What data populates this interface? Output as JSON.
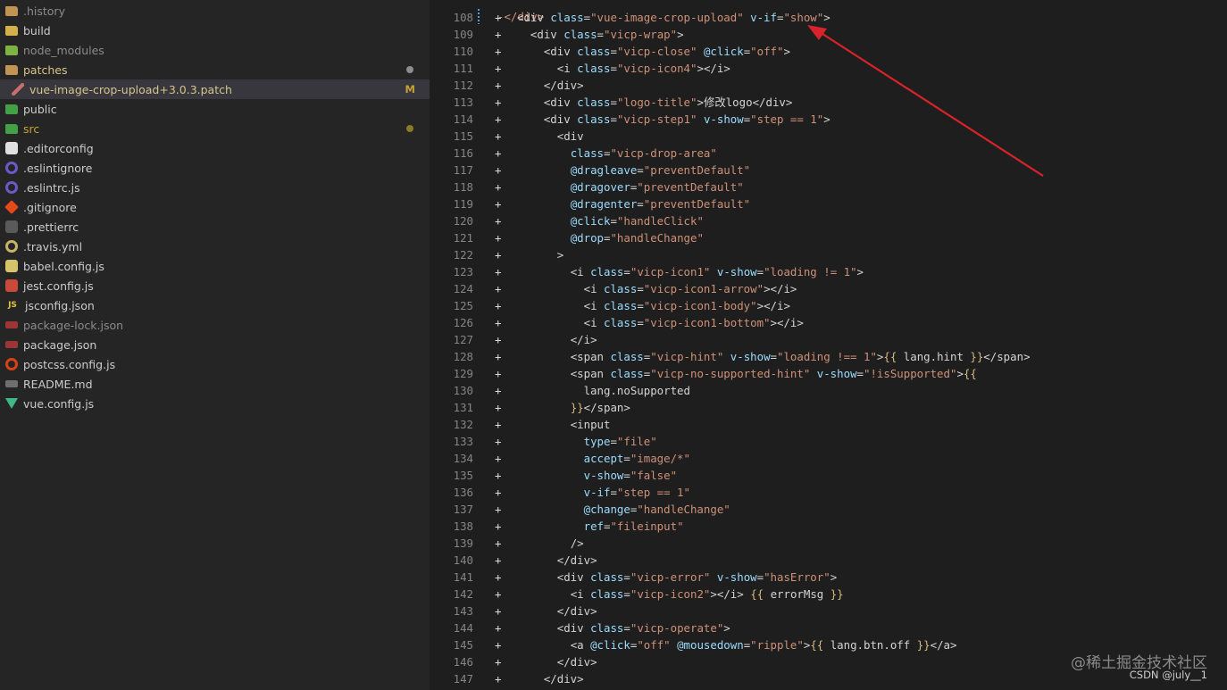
{
  "explorer": {
    "items": [
      {
        "label": ".history",
        "icon": "folder-icon",
        "icon_text": "",
        "icon_color": "#c09553",
        "label_color": "#8b8b8b"
      },
      {
        "label": "build",
        "icon": "build-folder-icon",
        "icon_text": "",
        "icon_color": "#d4b04d",
        "label_color": "#cccccc"
      },
      {
        "label": "node_modules",
        "icon": "node-modules-folder-icon",
        "icon_text": "",
        "icon_color": "#7cb342",
        "label_color": "#8b8b8b"
      },
      {
        "label": "patches",
        "icon": "folder-icon",
        "icon_text": "",
        "icon_color": "#c09553",
        "label_color": "#d7c48c",
        "dot_color": "#8d8d8d"
      },
      {
        "label": "vue-image-crop-upload+3.0.3.patch",
        "icon": "patch-file-icon",
        "icon_text": "",
        "icon_color": "#c56f6f",
        "label_color": "#d7c48c",
        "badge": "M",
        "selected": true,
        "indent": true
      },
      {
        "label": "public",
        "icon": "public-folder-icon",
        "icon_text": "",
        "icon_color": "#43a047",
        "label_color": "#cccccc"
      },
      {
        "label": "src",
        "icon": "src-folder-icon",
        "icon_text": "",
        "icon_color": "#43a047",
        "label_color": "#c5a333",
        "dot_color": "#8a7a2a"
      },
      {
        "label": ".editorconfig",
        "icon": "editorconfig-icon",
        "icon_text": "",
        "icon_color": "#e0e0e0",
        "label_color": "#cccccc"
      },
      {
        "label": ".eslintignore",
        "icon": "eslint-icon",
        "icon_text": "",
        "icon_color": "#6d58c9",
        "label_color": "#cccccc"
      },
      {
        "label": ".eslintrc.js",
        "icon": "eslint-icon",
        "icon_text": "",
        "icon_color": "#6d58c9",
        "label_color": "#cccccc"
      },
      {
        "label": ".gitignore",
        "icon": "git-icon",
        "icon_text": "",
        "icon_color": "#e64a19",
        "label_color": "#cccccc"
      },
      {
        "label": ".prettierrc",
        "icon": "prettier-icon",
        "icon_text": "",
        "icon_color": "#5a5a5a",
        "label_color": "#cccccc"
      },
      {
        "label": ".travis.yml",
        "icon": "travis-icon",
        "icon_text": "",
        "icon_color": "#c8b468",
        "label_color": "#cccccc"
      },
      {
        "label": "babel.config.js",
        "icon": "babel-icon",
        "icon_text": "",
        "icon_color": "#d6c46a",
        "label_color": "#cccccc"
      },
      {
        "label": "jest.config.js",
        "icon": "jest-icon",
        "icon_text": "",
        "icon_color": "#c74a3b",
        "label_color": "#cccccc"
      },
      {
        "label": "jsconfig.json",
        "icon": "js-icon",
        "icon_text": "JS",
        "icon_color": "#e0c341",
        "label_color": "#cccccc"
      },
      {
        "label": "package-lock.json",
        "icon": "npm-icon",
        "icon_text": "",
        "icon_color": "#b23a3a",
        "label_color": "#8b8b8b"
      },
      {
        "label": "package.json",
        "icon": "npm-icon",
        "icon_text": "",
        "icon_color": "#b23a3a",
        "label_color": "#cccccc"
      },
      {
        "label": "postcss.config.js",
        "icon": "postcss-icon",
        "icon_text": "",
        "icon_color": "#d84315",
        "label_color": "#cccccc"
      },
      {
        "label": "README.md",
        "icon": "markdown-icon",
        "icon_text": "",
        "icon_color": "#7d7d7d",
        "label_color": "#cccccc"
      },
      {
        "label": "vue.config.js",
        "icon": "vue-icon",
        "icon_text": "",
        "icon_color": "#41b883",
        "label_color": "#cccccc"
      }
    ]
  },
  "code": {
    "colors": {
      "tag": "#d4d4d4",
      "attr": "#9cdcfe",
      "str": "#ce9178",
      "brace": "#d7ba7d"
    },
    "top_partial": "-</div>",
    "lines": [
      {
        "n": "108",
        "text": "<div class=\"vue-image-crop-upload\" v-if=\"show\">"
      },
      {
        "n": "109",
        "text": "  <div class=\"vicp-wrap\">"
      },
      {
        "n": "110",
        "text": "    <div class=\"vicp-close\" @click=\"off\">"
      },
      {
        "n": "111",
        "text": "      <i class=\"vicp-icon4\"></i>"
      },
      {
        "n": "112",
        "text": "    </div>"
      },
      {
        "n": "113",
        "text": "    <div class=\"logo-title\">修改logo</div>"
      },
      {
        "n": "114",
        "text": "    <div class=\"vicp-step1\" v-show=\"step == 1\">"
      },
      {
        "n": "115",
        "text": "      <div"
      },
      {
        "n": "116",
        "text": "        class=\"vicp-drop-area\""
      },
      {
        "n": "117",
        "text": "        @dragleave=\"preventDefault\""
      },
      {
        "n": "118",
        "text": "        @dragover=\"preventDefault\""
      },
      {
        "n": "119",
        "text": "        @dragenter=\"preventDefault\""
      },
      {
        "n": "120",
        "text": "        @click=\"handleClick\""
      },
      {
        "n": "121",
        "text": "        @drop=\"handleChange\""
      },
      {
        "n": "122",
        "text": "      >"
      },
      {
        "n": "123",
        "text": "        <i class=\"vicp-icon1\" v-show=\"loading != 1\">"
      },
      {
        "n": "124",
        "text": "          <i class=\"vicp-icon1-arrow\"></i>"
      },
      {
        "n": "125",
        "text": "          <i class=\"vicp-icon1-body\"></i>"
      },
      {
        "n": "126",
        "text": "          <i class=\"vicp-icon1-bottom\"></i>"
      },
      {
        "n": "127",
        "text": "        </i>"
      },
      {
        "n": "128",
        "text": "        <span class=\"vicp-hint\" v-show=\"loading !== 1\">{{ lang.hint }}</span>"
      },
      {
        "n": "129",
        "text": "        <span class=\"vicp-no-supported-hint\" v-show=\"!isSupported\">{{"
      },
      {
        "n": "130",
        "text": "          lang.noSupported"
      },
      {
        "n": "131",
        "text": "        }}</span>"
      },
      {
        "n": "132",
        "text": "        <input"
      },
      {
        "n": "133",
        "text": "          type=\"file\""
      },
      {
        "n": "134",
        "text": "          accept=\"image/*\""
      },
      {
        "n": "135",
        "text": "          v-show=\"false\""
      },
      {
        "n": "136",
        "text": "          v-if=\"step == 1\""
      },
      {
        "n": "137",
        "text": "          @change=\"handleChange\""
      },
      {
        "n": "138",
        "text": "          ref=\"fileinput\""
      },
      {
        "n": "139",
        "text": "        />"
      },
      {
        "n": "140",
        "text": "      </div>"
      },
      {
        "n": "141",
        "text": "      <div class=\"vicp-error\" v-show=\"hasError\">"
      },
      {
        "n": "142",
        "text": "        <i class=\"vicp-icon2\"></i> {{ errorMsg }}"
      },
      {
        "n": "143",
        "text": "      </div>"
      },
      {
        "n": "144",
        "text": "      <div class=\"vicp-operate\">"
      },
      {
        "n": "145",
        "text": "        <a @click=\"off\" @mousedown=\"ripple\">{{ lang.btn.off }}</a>"
      },
      {
        "n": "146",
        "text": "      </div>"
      },
      {
        "n": "147",
        "text": "    </div>"
      }
    ]
  },
  "annotation": {
    "arrow_color": "#d8232a"
  },
  "watermark": {
    "line1": "@稀土掘金技术社区",
    "line2": "CSDN @july__1"
  }
}
